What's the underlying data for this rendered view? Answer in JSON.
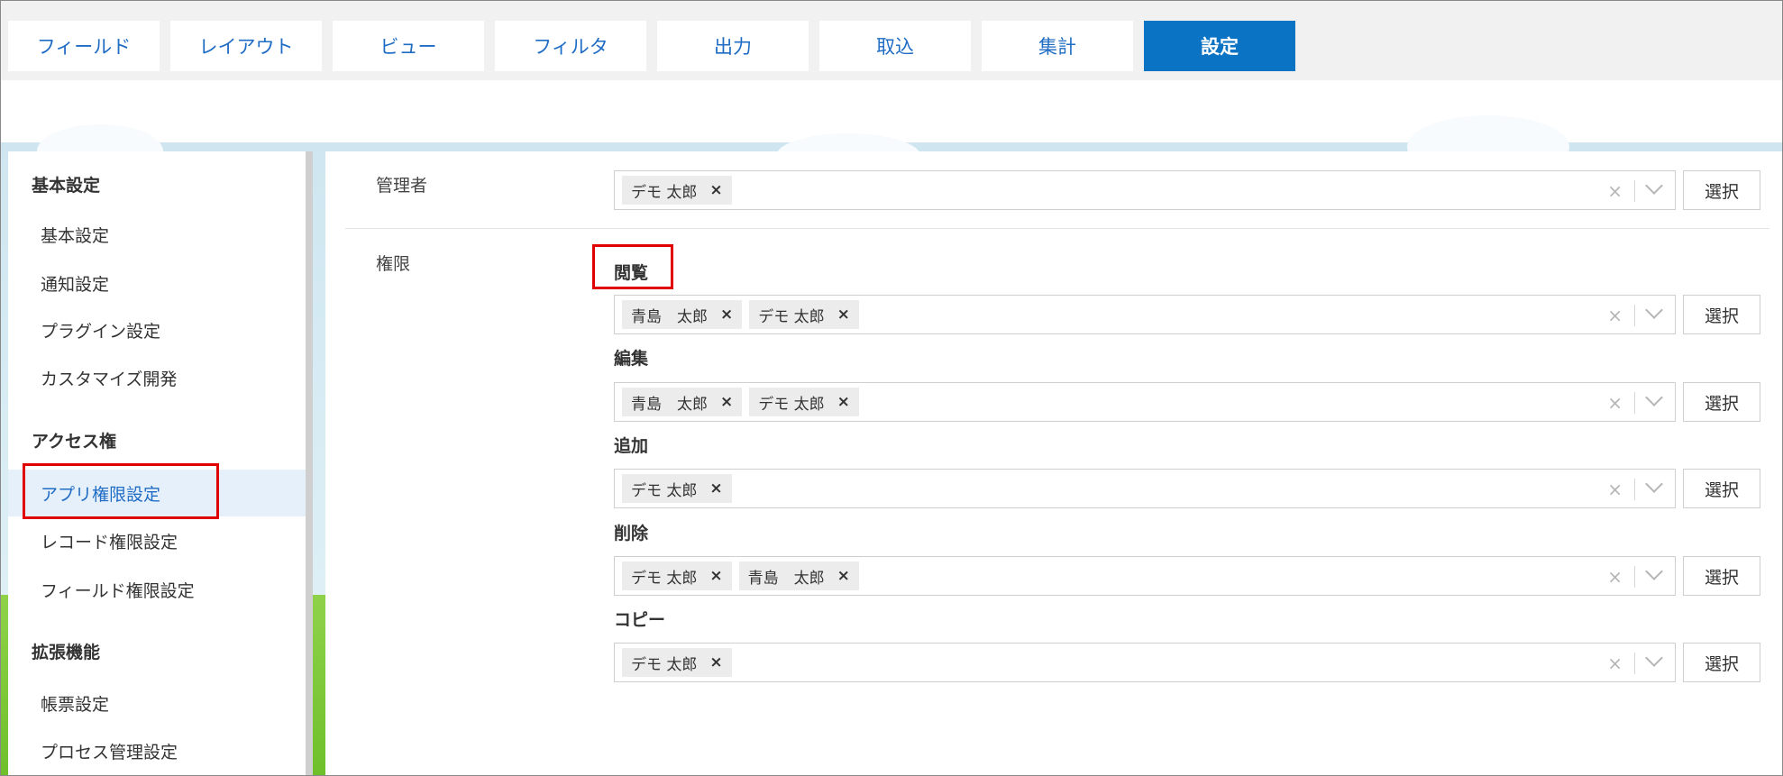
{
  "tabs": [
    {
      "label": "フィールド"
    },
    {
      "label": "レイアウト"
    },
    {
      "label": "ビュー"
    },
    {
      "label": "フィルタ"
    },
    {
      "label": "出力"
    },
    {
      "label": "取込"
    },
    {
      "label": "集計"
    },
    {
      "label": "設定"
    }
  ],
  "active_tab": "設定",
  "sidebar": {
    "sections": [
      {
        "title": "基本設定",
        "items": [
          "基本設定",
          "通知設定",
          "プラグイン設定",
          "カスタマイズ開発"
        ]
      },
      {
        "title": "アクセス権",
        "items": [
          "アプリ権限設定",
          "レコード権限設定",
          "フィールド権限設定"
        ]
      },
      {
        "title": "拡張機能",
        "items": [
          "帳票設定",
          "プロセス管理設定"
        ]
      }
    ],
    "active_item": "アプリ権限設定"
  },
  "admin": {
    "label": "管理者",
    "chips": [
      "デモ 太郎"
    ],
    "button": "選択"
  },
  "permissions": {
    "label": "権限",
    "groups": [
      {
        "label": "閲覧",
        "chips": [
          "青島　太郎",
          "デモ 太郎"
        ],
        "button": "選択"
      },
      {
        "label": "編集",
        "chips": [
          "青島　太郎",
          "デモ 太郎"
        ],
        "button": "選択"
      },
      {
        "label": "追加",
        "chips": [
          "デモ 太郎"
        ],
        "button": "選択"
      },
      {
        "label": "削除",
        "chips": [
          "デモ 太郎",
          "青島　太郎"
        ],
        "button": "選択"
      },
      {
        "label": "コピー",
        "chips": [
          "デモ 太郎"
        ],
        "button": "選択"
      }
    ]
  },
  "icons": {
    "chip_remove": "×",
    "clear": "×"
  },
  "colors": {
    "accent": "#0a73c3",
    "link": "#1f6cc4",
    "highlight": "#e00000"
  }
}
